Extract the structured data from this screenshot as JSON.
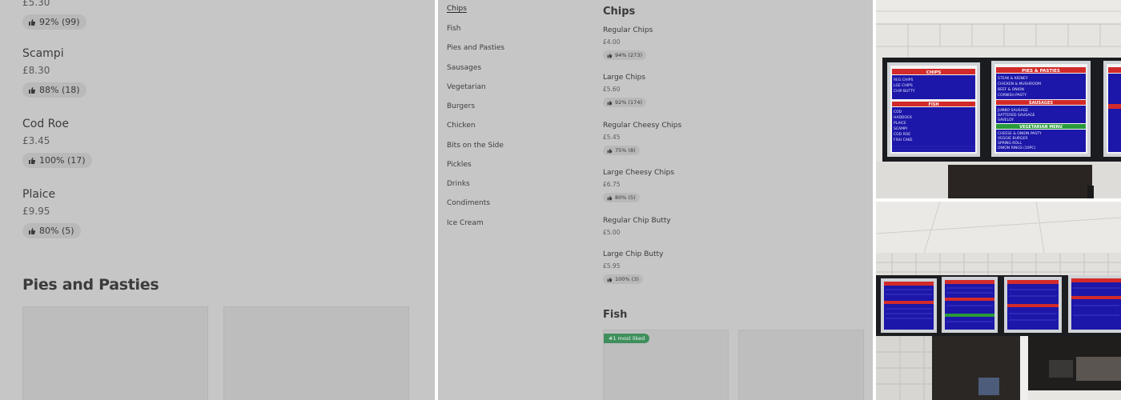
{
  "left_panel": {
    "top_price_partial": "£5.30",
    "top_rating": "92% (99)",
    "items": [
      {
        "name": "Scampi",
        "price": "£8.30",
        "rating": "88% (18)"
      },
      {
        "name": "Cod Roe",
        "price": "£3.45",
        "rating": "100% (17)"
      },
      {
        "name": "Plaice",
        "price": "£9.95",
        "rating": "80% (5)"
      }
    ],
    "section_title": "Pies and Pasties"
  },
  "middle_panel": {
    "nav": [
      {
        "label": "Chips",
        "active": true
      },
      {
        "label": "Fish"
      },
      {
        "label": "Pies and Pasties"
      },
      {
        "label": "Sausages"
      },
      {
        "label": "Vegetarian"
      },
      {
        "label": "Burgers"
      },
      {
        "label": "Chicken"
      },
      {
        "label": "Bits on the Side"
      },
      {
        "label": "Pickles"
      },
      {
        "label": "Drinks"
      },
      {
        "label": "Condiments"
      },
      {
        "label": "Ice Cream"
      }
    ],
    "section_chips": "Chips",
    "items": [
      {
        "name": "Regular Chips",
        "price": "£4.00",
        "rating": "94% (273)"
      },
      {
        "name": "Large Chips",
        "price": "£5.60",
        "rating": "92% (174)"
      },
      {
        "name": "Regular Cheesy Chips",
        "price": "£5.45",
        "rating": "75% (8)"
      },
      {
        "name": "Large Cheesy Chips",
        "price": "£6.75",
        "rating": "80% (5)"
      },
      {
        "name": "Regular Chip Butty",
        "price": "£5.00",
        "rating": ""
      },
      {
        "name": "Large Chip Butty",
        "price": "£5.95",
        "rating": "100% (3)"
      }
    ],
    "section_fish": "Fish",
    "badge": "#1 most liked"
  },
  "photos": {
    "top": {
      "boards": [
        {
          "header": "CHIPS",
          "lines": [
            "REG CHIPS",
            "LGE CHIPS",
            "CHIP BUTTY"
          ],
          "header2": "FISH",
          "lines2": [
            "COD",
            "HADDOCK",
            "PLAICE",
            "SCAMPI",
            "COD ROE",
            "FISH CAKE"
          ]
        },
        {
          "header": "PIES & PASTIES",
          "lines": [
            "STEAK & KIDNEY",
            "CHICKEN & MUSHROOM",
            "BEEF & ONION",
            "CORNISH PASTY"
          ],
          "header2": "SAUSAGES",
          "lines2": [
            "JUMBO SAUSAGE",
            "BATTERED SAUSAGE",
            "SAVELOY"
          ],
          "header3": "VEGETARIAN MENU",
          "lines3": [
            "CHEESE & ONION PASTY",
            "VEGGIE BURGER",
            "SPRING ROLL",
            "ONION RINGS (10PC)"
          ]
        }
      ]
    }
  },
  "colors": {
    "panel_bg": "#c6c6c6",
    "badge_green": "#3f8f5d",
    "board_blue": "#1c17a8",
    "board_red": "#d22a2a",
    "board_green": "#2a9a3a"
  }
}
